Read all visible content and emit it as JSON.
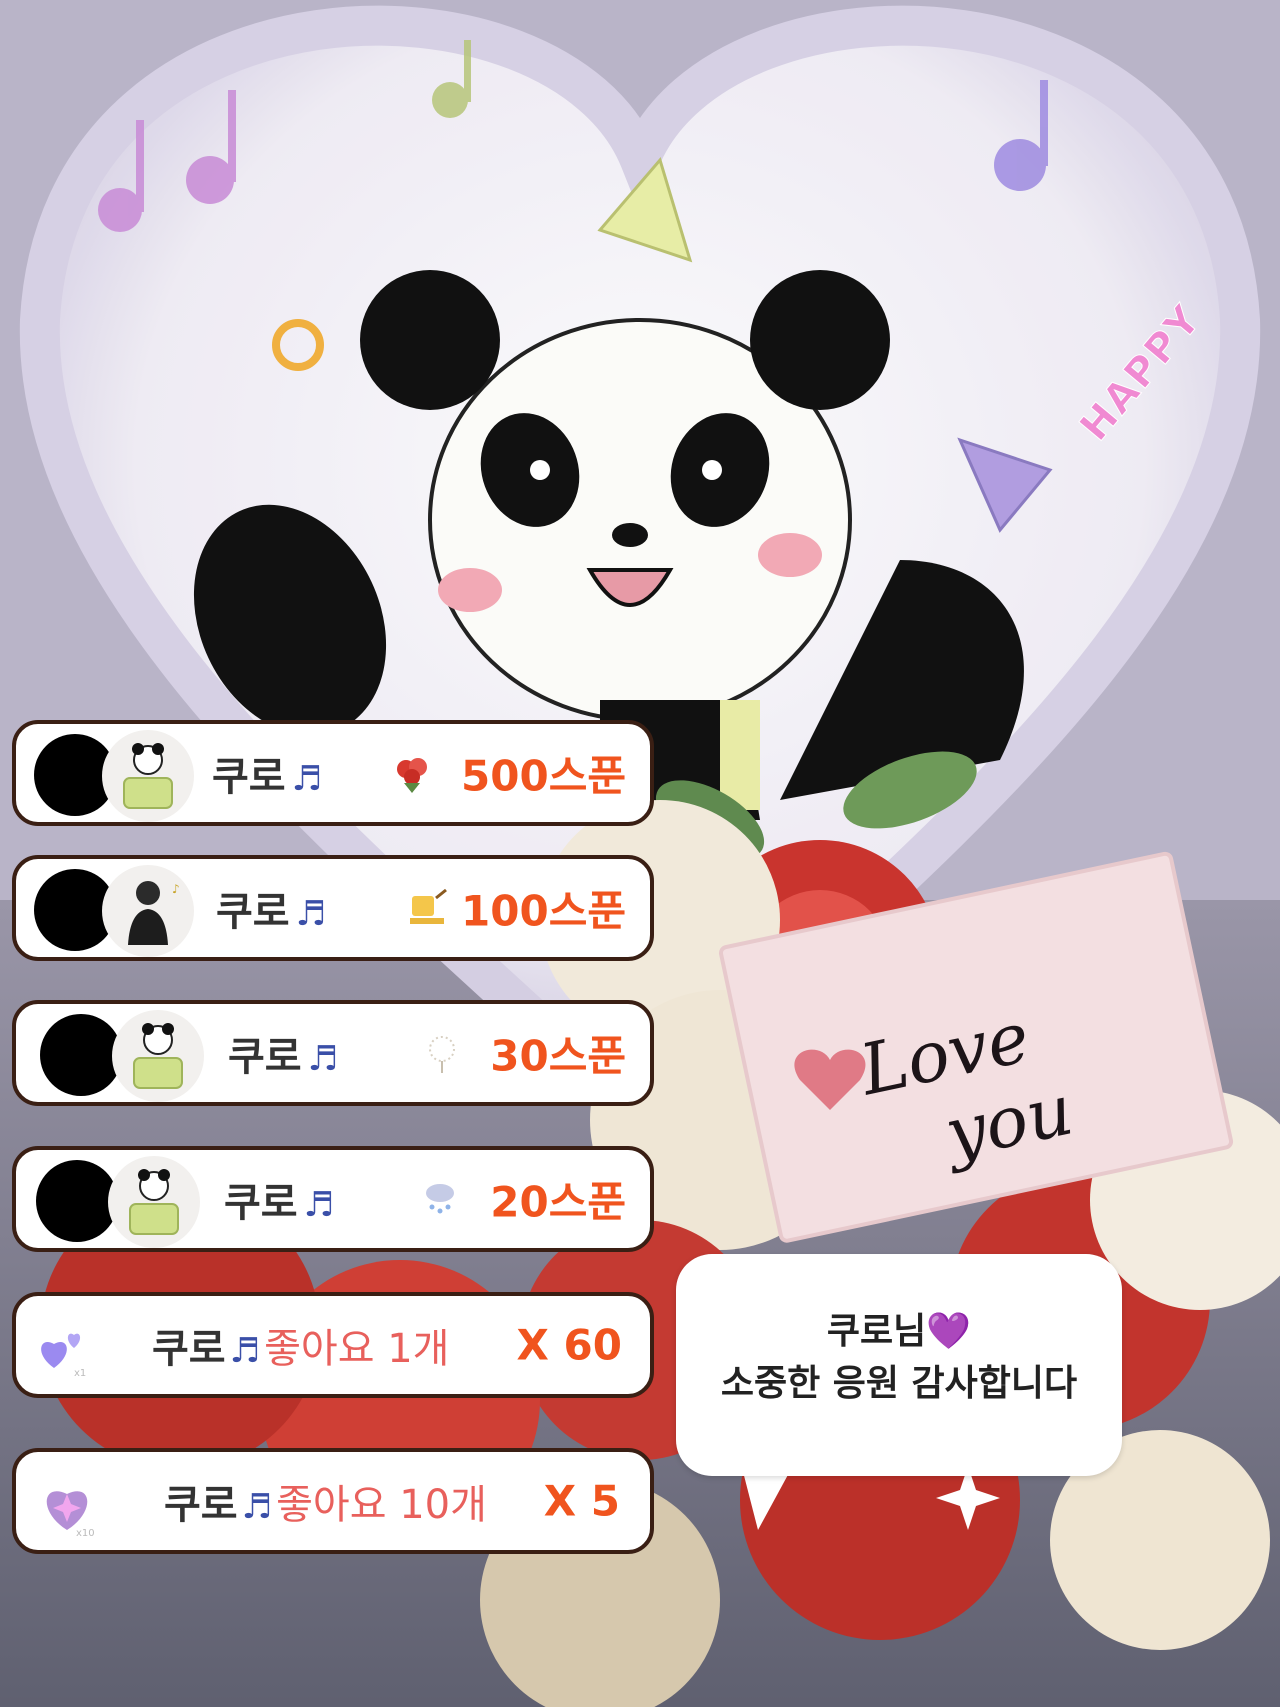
{
  "decoration": {
    "happy_text": "HAPPY",
    "love_text_line1": "Love",
    "love_text_line2": "you"
  },
  "gift_rows": [
    {
      "nickname": "쿠로",
      "note_icon": "music-note-icon",
      "gift_icon": "rose-bouquet-icon",
      "amount": "500스푼"
    },
    {
      "nickname": "쿠로",
      "note_icon": "music-note-icon",
      "gift_icon": "gift-sticker-icon",
      "amount": "100스푼"
    },
    {
      "nickname": "쿠로",
      "note_icon": "music-note-icon",
      "gift_icon": "dandelion-icon",
      "amount": "30스푼"
    },
    {
      "nickname": "쿠로",
      "note_icon": "music-note-icon",
      "gift_icon": "rain-cloud-icon",
      "amount": "20스푼"
    }
  ],
  "like_rows": [
    {
      "nickname": "쿠로",
      "likes_text": "좋아요 1개",
      "multiplier": "X 60",
      "badge": "x1"
    },
    {
      "nickname": "쿠로",
      "likes_text": "좋아요 10개",
      "multiplier": "X 5",
      "badge": "x10"
    }
  ],
  "message_bubble": {
    "line1": "쿠로님💜",
    "line2": "소중한 응원 감사합니다"
  },
  "colors": {
    "amount": "#f0541e",
    "like_label": "#e8605c",
    "card_border": "#3a1f14",
    "note": "#3a4fa8"
  }
}
